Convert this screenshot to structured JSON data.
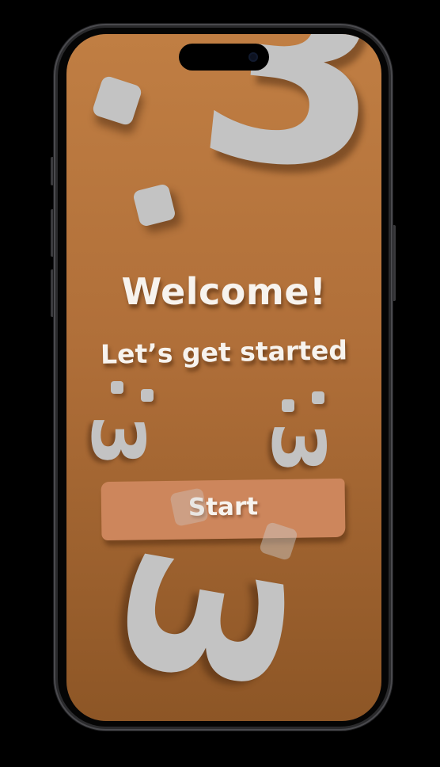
{
  "app": {
    "welcome_title": "Welcome!",
    "subtitle": "Let’s get started",
    "start_label": "Start"
  },
  "decorations": {
    "big_top_glyph": "3",
    "big_bottom_glyph": "3",
    "face_mouth_glyph": "3"
  },
  "colors": {
    "background_top": "#c07e43",
    "background_bottom": "#8d5626",
    "button": "#cd865c",
    "text": "#f7f3ee",
    "decoration": "#c3c3c3"
  }
}
